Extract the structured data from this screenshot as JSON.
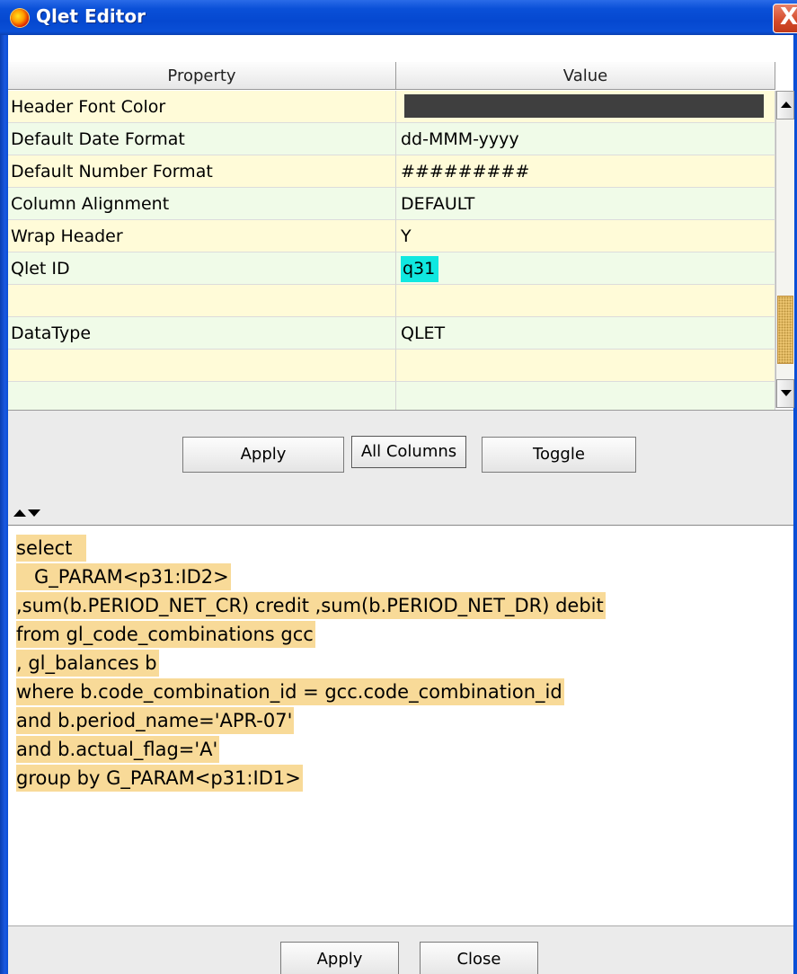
{
  "window": {
    "title": "Qlet Editor",
    "close_glyph": "X"
  },
  "table": {
    "headers": {
      "property": "Property",
      "value": "Value"
    },
    "rows": [
      {
        "property": "Header Font Color",
        "value": "",
        "color_swatch": "#3f3f3f"
      },
      {
        "property": "Default Date Format",
        "value": "dd-MMM-yyyy"
      },
      {
        "property": "Default Number Format",
        "value": "#########"
      },
      {
        "property": "Column Alignment",
        "value": "DEFAULT"
      },
      {
        "property": "Wrap Header",
        "value": "Y"
      },
      {
        "property": "Qlet ID",
        "value": "q31"
      },
      {
        "property": "",
        "value": ""
      },
      {
        "property": "DataType",
        "value": "QLET"
      },
      {
        "property": "",
        "value": ""
      },
      {
        "property": "",
        "value": ""
      },
      {
        "property": "",
        "value": ""
      }
    ]
  },
  "toolbar": {
    "apply_label": "Apply",
    "all_columns_label": "All Columns",
    "toggle_label": "Toggle"
  },
  "sql": {
    "lines": [
      "select  ",
      "   G_PARAM<p31:ID2>",
      ",sum(b.PERIOD_NET_CR) credit ,sum(b.PERIOD_NET_DR) debit",
      "from gl_code_combinations gcc",
      ", gl_balances b",
      "where b.code_combination_id = gcc.code_combination_id",
      "and b.period_name='APR-07'",
      "and b.actual_flag='A'",
      "group by G_PARAM<p31:ID1>"
    ]
  },
  "footer": {
    "apply_label": "Apply",
    "close_label": "Close"
  },
  "colors": {
    "row_yellow": "#fffbd8",
    "row_green": "#f0fbe8",
    "sql_highlight": "#f8da98",
    "id_highlight": "#10e8e0",
    "titlebar": "#0a50d8"
  }
}
